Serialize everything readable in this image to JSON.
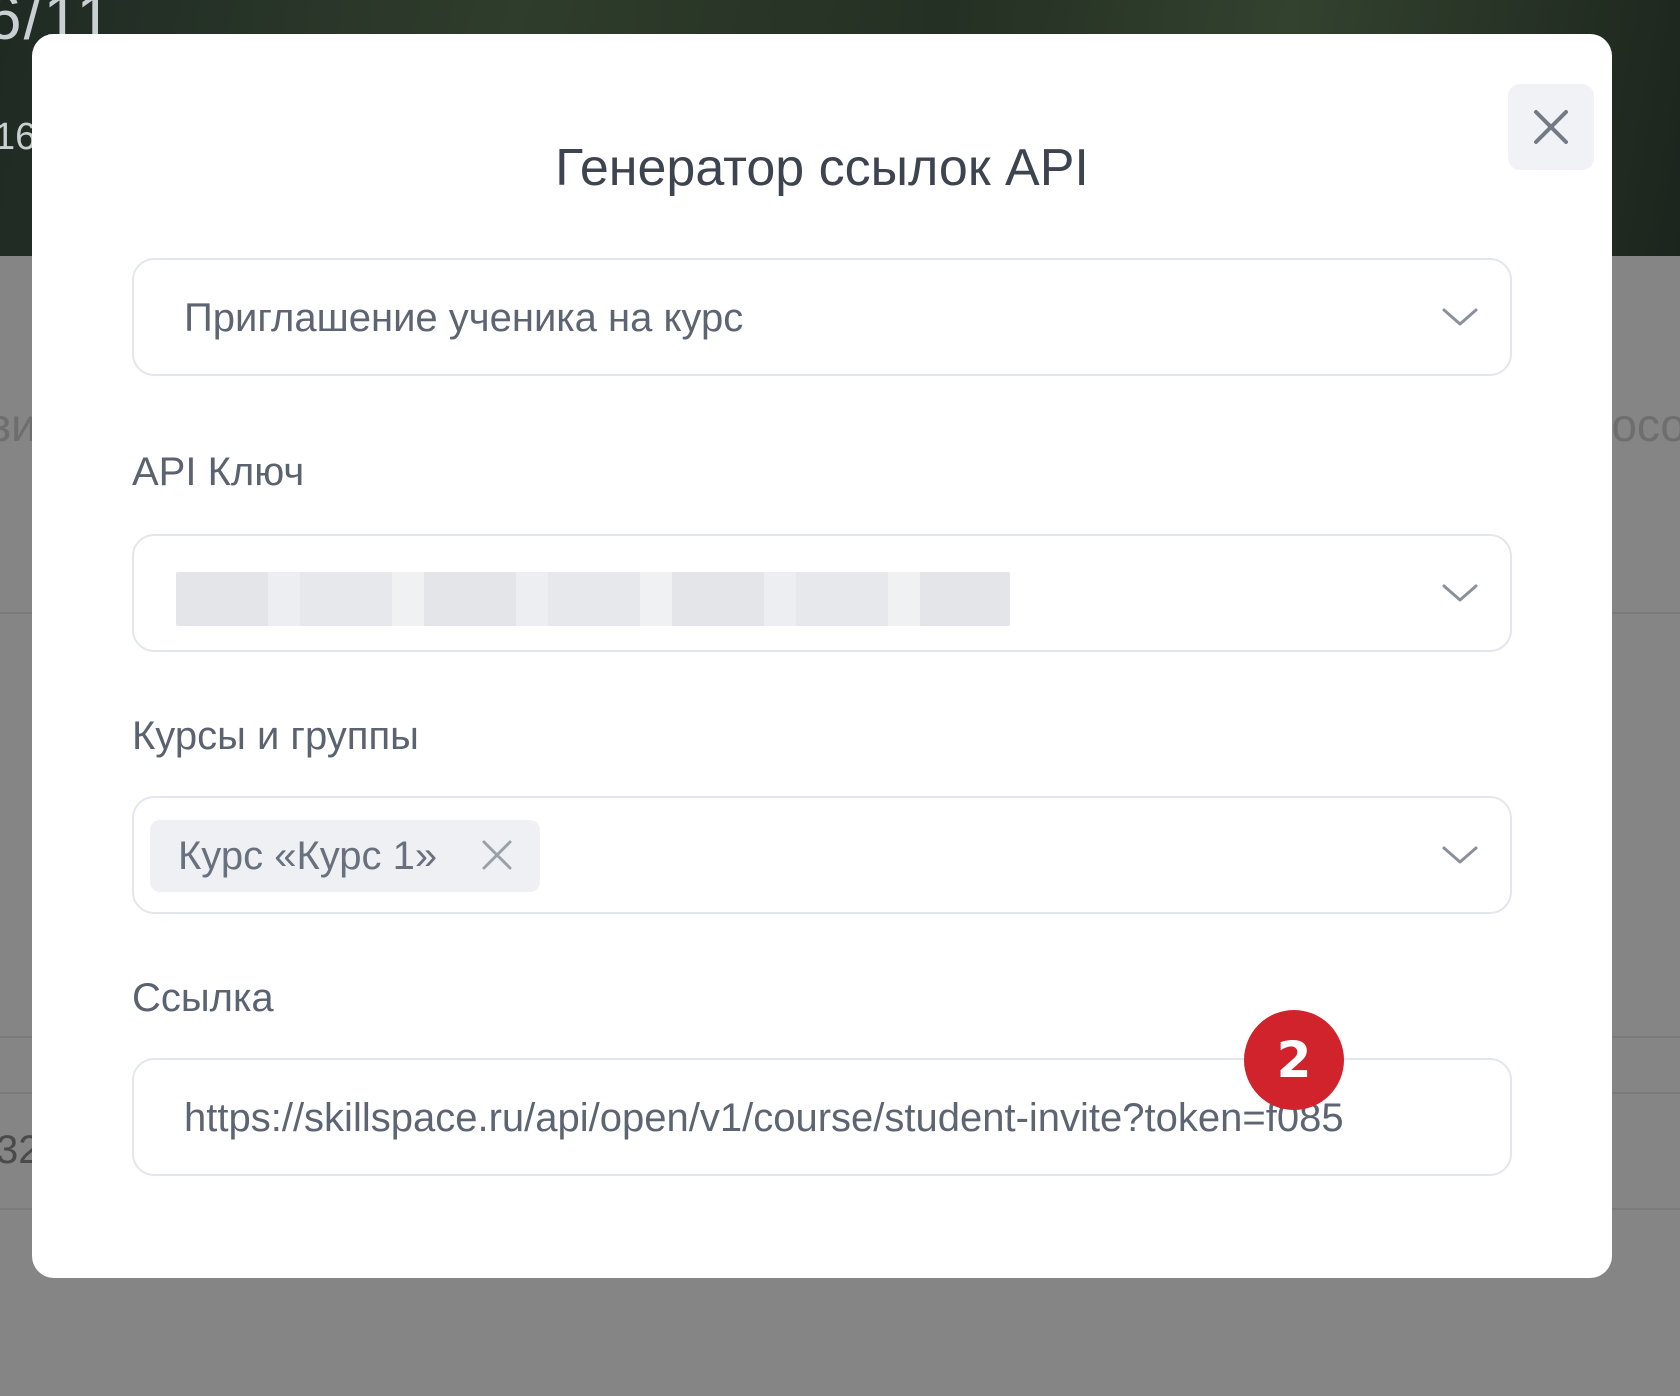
{
  "background": {
    "banner_title": "6/11",
    "banner_sub": "16",
    "tab_left_fragment": "зи",
    "tab_right_fragment": "осо",
    "row_cell_fragment": "32"
  },
  "modal": {
    "title": "Генератор ссылок API",
    "close_icon": "close-icon",
    "link_type_select": {
      "value": "Приглашение ученика на курс",
      "icon": "chevron-down-icon"
    },
    "api_key": {
      "label": "API Ключ",
      "value_masked": true,
      "icon": "chevron-down-icon"
    },
    "courses": {
      "label": "Курсы и группы",
      "selected_chips": [
        "Курс «Курс 1»"
      ],
      "icon": "chevron-down-icon"
    },
    "link": {
      "label": "Ссылка",
      "value": "https://skillspace.ru/api/open/v1/course/student-invite?token=f085"
    }
  },
  "annotation_badge": "2",
  "colors": {
    "overlay": "#858585",
    "badge": "#d1232b",
    "text": "#3d4450",
    "border": "#e3e6ec"
  }
}
